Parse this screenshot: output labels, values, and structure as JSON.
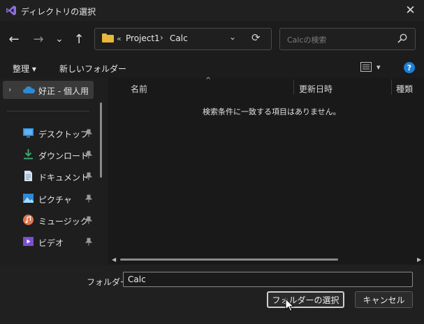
{
  "window": {
    "title": "ディレクトリの選択",
    "close_glyph": "✕"
  },
  "nav": {
    "back": "←",
    "forward": "→",
    "recent": "⌄",
    "up": "↑",
    "address_prefix": "«",
    "breadcrumbs": [
      "Project1",
      "Calc"
    ],
    "breadcrumb_sep": "›",
    "dropdown": "⌄",
    "refresh": "⟳",
    "search_placeholder": "Calcの検索"
  },
  "toolbar": {
    "organize": "整理 ▾",
    "new_folder": "新しいフォルダー",
    "help": "?"
  },
  "sidebar": {
    "top_item": {
      "chevron": "›",
      "label": "好正 - 個人用",
      "icon": "onedrive-cloud-icon"
    },
    "quick_access": [
      {
        "label": "デスクトップ",
        "icon": "desktop-icon",
        "color": "#2d8bd6"
      },
      {
        "label": "ダウンロード",
        "icon": "download-icon",
        "color": "#3aa66e"
      },
      {
        "label": "ドキュメント",
        "icon": "document-icon",
        "color": "#9fb6d4"
      },
      {
        "label": "ピクチャ",
        "icon": "pictures-icon",
        "color": "#2d8bd6"
      },
      {
        "label": "ミュージック",
        "icon": "music-icon",
        "color": "#e0764e"
      },
      {
        "label": "ビデオ",
        "icon": "video-icon",
        "color": "#7b4fd0"
      }
    ]
  },
  "content": {
    "columns": [
      "名前",
      "更新日時",
      "種類"
    ],
    "sort_indicator": "^",
    "empty_message": "検索条件に一致する項目はありません。"
  },
  "footer": {
    "folder_label": "フォルダー:",
    "folder_value": "Calc",
    "select_button": "フォルダーの選択",
    "cancel_button": "キャンセル"
  },
  "colors": {
    "accent": "#1f7fd6",
    "folder": "#e8b83a",
    "vs_purple": "#7b5fd6"
  }
}
